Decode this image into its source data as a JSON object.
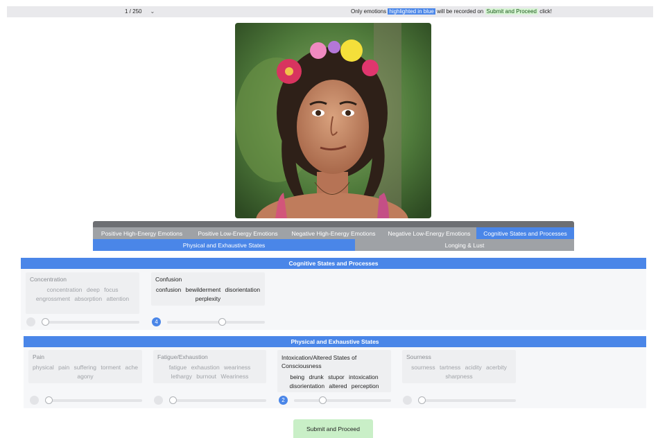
{
  "topbar": {
    "page_indicator": "1 / 250",
    "chevron": "chevron-down-icon",
    "notice_before": "Only emotions",
    "notice_blue": "highlighted in blue",
    "notice_middle": "will be recorded on",
    "notice_green": "Submit and Proceed",
    "notice_after": "click!"
  },
  "photo": {
    "description_icon": "portrait-photo"
  },
  "category_tabs": {
    "row1": [
      "Positive High-Energy Emotions",
      "Positive Low-Energy Emotions",
      "Negative High-Energy Emotions",
      "Negative Low-Energy Emotions",
      "Cognitive States and Processes"
    ],
    "row2": [
      "Physical and Exhaustive States",
      "Longing & Lust"
    ],
    "active": [
      "Cognitive States and Processes",
      "Physical and Exhaustive States"
    ]
  },
  "sections": [
    {
      "title": "Cognitive States and Processes",
      "emotions": [
        {
          "name": "Concentration",
          "synonyms": "concentration deep focus engrossment absorption attention",
          "level": 0,
          "selected": false
        },
        {
          "name": "Confusion",
          "synonyms": "confusion bewilderment disorientation perplexity",
          "level": 4,
          "selected": true
        }
      ]
    },
    {
      "title": "Physical and Exhaustive States",
      "emotions": [
        {
          "name": "Pain",
          "synonyms": "physical pain suffering torment ache agony",
          "level": 0,
          "selected": false
        },
        {
          "name": "Fatigue/Exhaustion",
          "synonyms": "fatigue exhaustion weariness lethargy burnout Weariness",
          "level": 0,
          "selected": false
        },
        {
          "name": "Intoxication/Altered States of Consciousness",
          "synonyms": "being drunk stupor intoxication disorientation altered perception",
          "level": 2,
          "selected": true
        },
        {
          "name": "Sourness",
          "synonyms": "sourness tartness acidity acerbity sharpness",
          "level": 0,
          "selected": false
        }
      ]
    }
  ],
  "submit_label": "Submit and Proceed",
  "colors": {
    "accent": "#4a86e8",
    "submit": "#c9efc7"
  }
}
